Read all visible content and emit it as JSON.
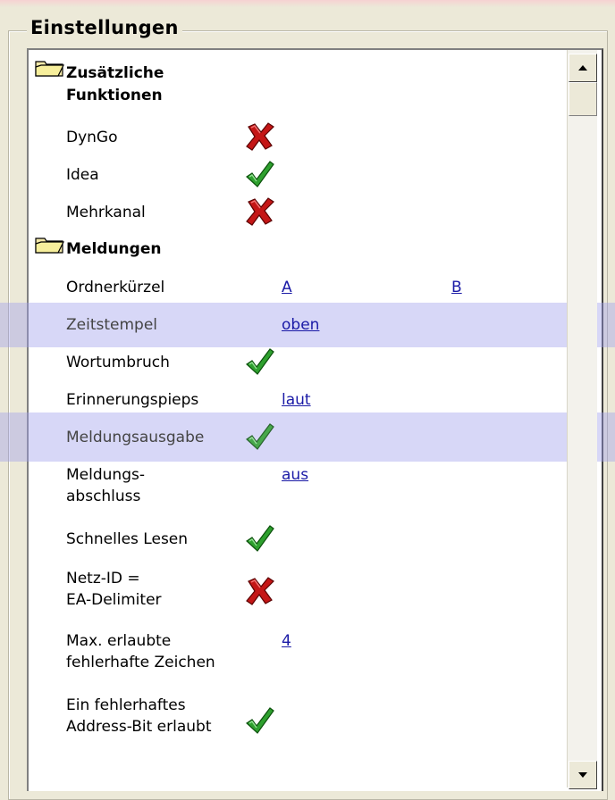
{
  "groupbox": {
    "title": "Einstellungen"
  },
  "sections": [
    {
      "title_line1": "Zusätzliche",
      "title_line2": "Funktionen"
    },
    {
      "title": "Meldungen"
    }
  ],
  "rows": {
    "dyngo": {
      "label": "DynGo",
      "state": "off"
    },
    "idea": {
      "label": "Idea",
      "state": "on"
    },
    "mehrkanal": {
      "label": "Mehrkanal",
      "state": "off"
    },
    "ordnerkuerzel": {
      "label": "Ordnerkürzel",
      "value_a": "A",
      "value_b": "B"
    },
    "zeitstempel": {
      "label": "Zeitstempel",
      "value": "oben"
    },
    "wortumbruch": {
      "label": "Wortumbruch",
      "state": "on"
    },
    "erinnerungspieps": {
      "label": "Erinnerungspieps",
      "value": "laut"
    },
    "meldungsausgabe": {
      "label": "Meldungsausgabe",
      "state": "on"
    },
    "meldungsabschluss": {
      "label_line1": "Meldungs-",
      "label_line2": "abschluss",
      "value": "aus"
    },
    "schnelles_lesen": {
      "label": "Schnelles Lesen",
      "state": "on"
    },
    "netz_id": {
      "label_line1": "Netz-ID =",
      "label_line2": "EA-Delimiter",
      "state": "off"
    },
    "max_fehler": {
      "label_line1": "Max. erlaubte",
      "label_line2": "fehlerhafte Zeichen",
      "value": "4"
    },
    "address_bit": {
      "label_line1": "Ein fehlerhaftes",
      "label_line2": "Address-Bit erlaubt",
      "state": "on"
    }
  },
  "colors": {
    "highlight_band": "#a0a0eb",
    "check_green": "#2ea02e",
    "cross_red": "#c41616",
    "link_blue": "#1a1aa6"
  },
  "icons": {
    "folder": "folder-icon",
    "on": "checkmark-icon",
    "off": "red-x-icon",
    "scroll_up": "scroll-up-arrow-icon",
    "scroll_down": "scroll-down-arrow-icon"
  }
}
